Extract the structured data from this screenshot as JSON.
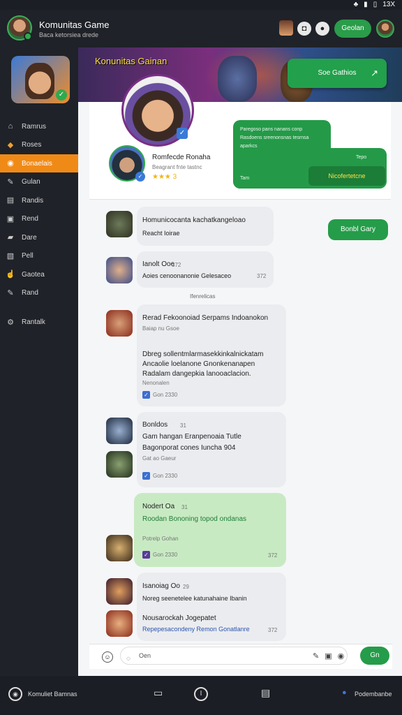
{
  "status_bar": {
    "icons": [
      "♣",
      "▮",
      "▯",
      "13X"
    ]
  },
  "header": {
    "title": "Komunitas Game",
    "subtitle": "Baca ketorsiea drede",
    "green_button": "Geolan"
  },
  "sidebar": {
    "items": [
      {
        "label": "Ramrus",
        "icon": "home-icon",
        "glyph": "⌂"
      },
      {
        "label": "Roses",
        "icon": "bag-icon",
        "glyph": "◆"
      },
      {
        "label": "Bonaelais",
        "icon": "chat-icon",
        "glyph": "◉",
        "active": true
      },
      {
        "label": "Gulan",
        "icon": "pen-icon",
        "glyph": "✎"
      },
      {
        "label": "Randis",
        "icon": "list-icon",
        "glyph": "▤"
      },
      {
        "label": "Rend",
        "icon": "doc-icon",
        "glyph": "▣"
      },
      {
        "label": "Dare",
        "icon": "bag-icon",
        "glyph": "▰"
      },
      {
        "label": "Pell",
        "icon": "doc-icon",
        "glyph": "▧"
      },
      {
        "label": "Gaotea",
        "icon": "hand-icon",
        "glyph": "☝"
      },
      {
        "label": "Rand",
        "icon": "pen-icon",
        "glyph": "✎"
      },
      {
        "label": "Rantalk",
        "icon": "settings-icon",
        "glyph": "⚙"
      }
    ]
  },
  "banner": {
    "title": "Konunitas Gainan",
    "button": "Soe Gathios"
  },
  "profile": {
    "name": "Romfecde Ronaha",
    "sub": "Beagrant fnte tastnc",
    "stars": "★★★ 3"
  },
  "green_message": {
    "line1": "Paregoso pans nanans conp",
    "line2": "Rasdoens sreenonsnas tesrnsa",
    "line3": "aparkcs",
    "time1": "Tepo",
    "time2": "Tam",
    "inner_button": "Nicofertetcne"
  },
  "feed": {
    "msg1": {
      "title": "Homunicocanta kachatkangeloao",
      "body": "Reacht Ioirae"
    },
    "msg2": {
      "title": "Ianolt Ooe",
      "body": "Aoies cenoonanonie Gelesaceo",
      "time": "372"
    },
    "pill_right": "Bonbl Gary",
    "divider": "Ifenrelicas",
    "msg3": {
      "title": "Rerad Fekoonoiad Serpams Indoanokon",
      "meta": "Baiap nu Gsoe",
      "line1": "Dbreg sollentmlarmasekkinkalnickatam",
      "line2": "Ancaolie loelanone Gnonkenanapen",
      "line3": "Radalam dangepkia lanooaclacion.",
      "line4": "Nenonalen",
      "footer": "Gon 2330"
    },
    "msg4": {
      "title": "Bonldos",
      "line1": "Gam hangan Eranpenoaia Tutle",
      "line2": "Bagonporat cones Iuncha 904",
      "line3": "Gat ao Gaeur",
      "footer": "Gon 2330",
      "count": "31"
    },
    "msg5": {
      "title": "Nodert Oa",
      "line1": "Roodan Bononing topod ondanas",
      "line2": "Potrelp Gohan",
      "footer": "Gon 2330",
      "count": "31",
      "time": "372"
    },
    "msg6": {
      "title": "Isanoiag Oo",
      "line1": "Noreg seenetelee katunahaine Ibanin",
      "title2": "Nousarockah Jogepatet",
      "line2": "Repepesacondeny Remon Gonatlanre",
      "count": "29",
      "time": "372"
    }
  },
  "composer": {
    "placeholder": "Oen",
    "send": "Gn"
  },
  "bottom_bar": {
    "left_label": "Komuliet Bamnas",
    "right_label": "Podembanbe"
  },
  "colors": {
    "accent": "#f08a17",
    "green": "#249a48",
    "panel": "#1f2228"
  }
}
